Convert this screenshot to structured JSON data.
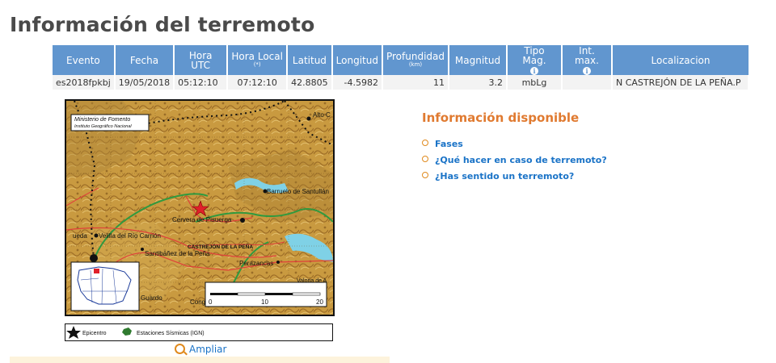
{
  "page": {
    "title": "Información del terremoto"
  },
  "table": {
    "headers": [
      {
        "label": "Evento",
        "sub": "",
        "info": false
      },
      {
        "label": "Fecha",
        "sub": "",
        "info": false
      },
      {
        "label": "Hora UTC",
        "sub": "",
        "info": false
      },
      {
        "label": "Hora Local",
        "sub": "(*)",
        "info": false
      },
      {
        "label": "Latitud",
        "sub": "",
        "info": false
      },
      {
        "label": "Longitud",
        "sub": "",
        "info": false
      },
      {
        "label": "Profundidad",
        "sub": "(km)",
        "info": false
      },
      {
        "label": "Magnitud",
        "sub": "",
        "info": false
      },
      {
        "label": "Tipo Mag.",
        "sub": "",
        "info": true
      },
      {
        "label": "Int. max.",
        "sub": "",
        "info": true
      },
      {
        "label": "Localizacion",
        "sub": "",
        "info": false
      }
    ],
    "row": [
      "es2018fpkbj",
      "19/05/2018",
      "05:12:10",
      "07:12:10",
      "42.8805",
      "-4.5982",
      "11",
      "3.2",
      "mbLg",
      "",
      "N CASTREJÓN DE LA PEÑA.P"
    ]
  },
  "map": {
    "credit_line1": "Ministerio de Fomento",
    "credit_line2": "Instituto Geográfico Nacional",
    "places": {
      "alto": "Alto C",
      "barruelo": "Barruelo de Santullán",
      "cervera": "Cervera de Pisuerga",
      "velilla": "Velilla del Río Carrión",
      "cueda": "ueda",
      "castrejon": "CASTREJÓN DE LA PEÑA",
      "santibanez": "Santibáñez de la Peña",
      "perazancas": "Perazancas",
      "valoria": "Valoria de A",
      "guardo": "Guardo",
      "cong": "Cong"
    },
    "scale": {
      "labels": [
        "0",
        "10",
        "20"
      ]
    }
  },
  "legend": {
    "epicentro": "Epicentro",
    "estaciones": "Estaciones Sísmicas (IGN)"
  },
  "links": {
    "ampliar": "Ampliar"
  },
  "info": {
    "title": "Información disponible",
    "items": [
      "Fases",
      "¿Qué hacer en caso de terremoto?",
      "¿Has sentido un terremoto?"
    ]
  },
  "colors": {
    "accent_blue": "#6196cf",
    "link_blue": "#1a73c7",
    "orange": "#e07a30",
    "epicenter_red": "#e0202a"
  }
}
